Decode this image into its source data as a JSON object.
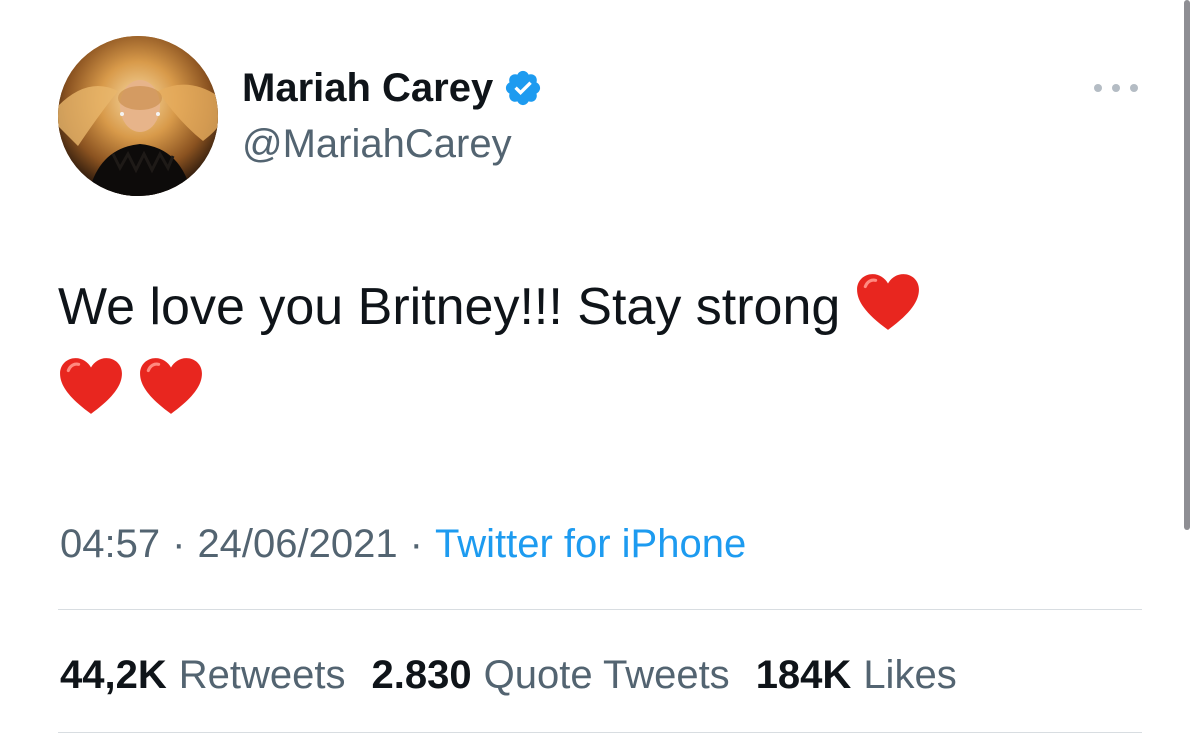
{
  "user": {
    "display_name": "Mariah Carey",
    "handle": "@MariahCarey",
    "verified": true,
    "avatar_icon": "profile-photo"
  },
  "tweet": {
    "text": "We love you Britney!!! Stay strong",
    "emoji": [
      "red-heart",
      "red-heart",
      "red-heart"
    ]
  },
  "meta": {
    "time": "04:57",
    "separator": "·",
    "date": "24/06/2021",
    "source": "Twitter for iPhone"
  },
  "stats": {
    "retweets_count": "44,2K",
    "retweets_label": "Retweets",
    "quotes_count": "2.830",
    "quotes_label": "Quote Tweets",
    "likes_count": "184K",
    "likes_label": "Likes"
  },
  "colors": {
    "link": "#1d9bf0",
    "verified": "#1d9bf0",
    "secondary_text": "#536471",
    "heart": "#e8261f"
  }
}
